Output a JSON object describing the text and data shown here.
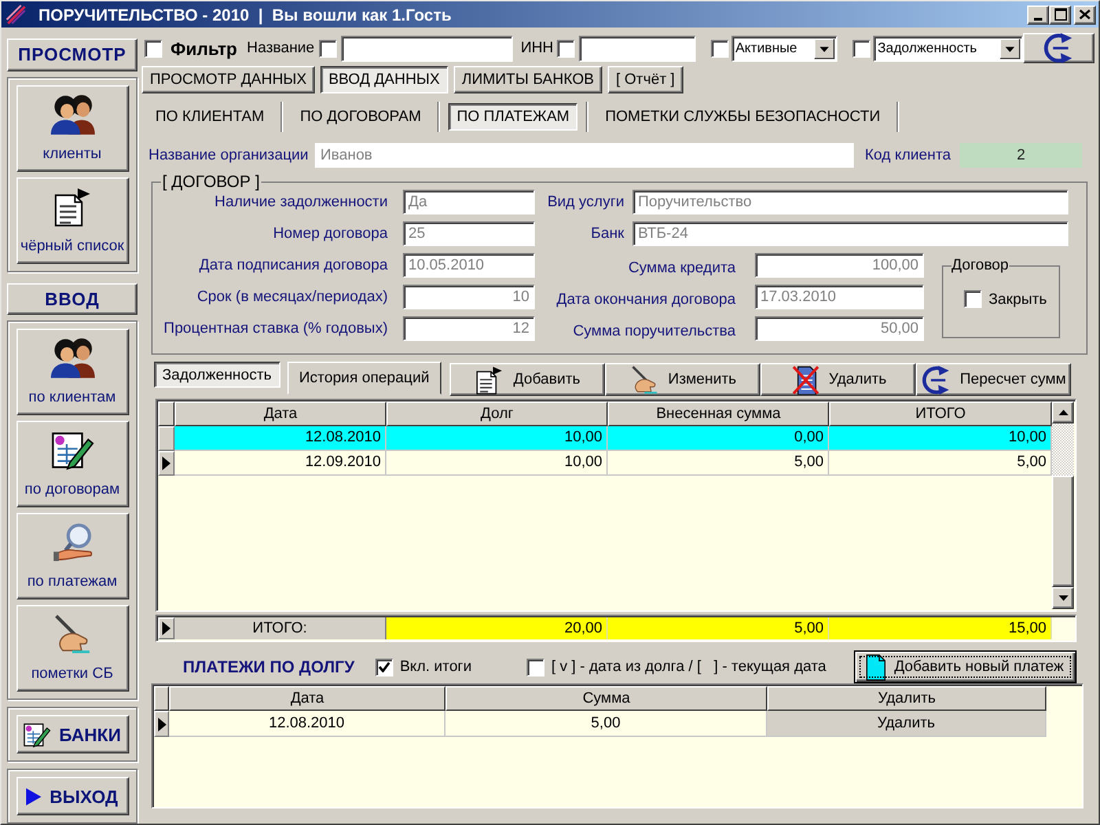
{
  "window": {
    "title": "ПОРУЧИТЕЛЬСТВО - 2010  |  Вы вошли как 1.Гость"
  },
  "sidebar": {
    "sections": [
      {
        "title": "ПРОСМОТР",
        "items": [
          {
            "label": "клиенты"
          },
          {
            "label": "чёрный список"
          }
        ]
      },
      {
        "title": "ВВОД",
        "items": [
          {
            "label": "по клиентам"
          },
          {
            "label": "по договорам"
          },
          {
            "label": "по платежам"
          },
          {
            "label": "пометки СБ"
          }
        ]
      }
    ],
    "buttons": [
      {
        "label": "БАНКИ"
      },
      {
        "label": "ВЫХОД"
      }
    ]
  },
  "filter": {
    "label": "Фильтр",
    "checked": false,
    "fields": [
      {
        "label": "Название",
        "checked": false
      },
      {
        "label": "ИНН",
        "checked": false
      }
    ],
    "dropdowns": [
      {
        "value": "Активные",
        "checked": false
      },
      {
        "value": "Задолженность",
        "checked": false
      }
    ]
  },
  "tabs": [
    {
      "label": "ПРОСМОТР ДАННЫХ",
      "selected": false
    },
    {
      "label": "ВВОД ДАННЫХ",
      "selected": true
    },
    {
      "label": "ЛИМИТЫ БАНКОВ",
      "selected": false
    },
    {
      "label": "[ Отчёт ]",
      "selected": false
    }
  ],
  "subtabs": [
    {
      "label": "ПО КЛИЕНТАМ",
      "selected": false
    },
    {
      "label": "ПО ДОГОВОРАМ",
      "selected": false
    },
    {
      "label": "ПО ПЛАТЕЖАМ",
      "selected": true
    },
    {
      "label": "ПОМЕТКИ СЛУЖБЫ БЕЗОПАСНОСТИ",
      "selected": false
    }
  ],
  "client": {
    "name_label": "Название организации",
    "name": "Иванов",
    "code_label": "Код клиента",
    "code": "2"
  },
  "contract": {
    "title": "[ ДОГОВОР ]",
    "left_fields": [
      {
        "label": "Наличие задолженности",
        "value": "Да",
        "kind": "text"
      },
      {
        "label": "Номер договора",
        "value": "25",
        "kind": "text"
      },
      {
        "label": "Дата подписания договора",
        "value": "10.05.2010",
        "kind": "text"
      },
      {
        "label": "Срок (в месяцах/периодах)",
        "value": "10",
        "kind": "number"
      },
      {
        "label": "Процентная ставка (% годовых)",
        "value": "12",
        "kind": "number"
      }
    ],
    "right_top_fields": [
      {
        "label": "Вид услуги",
        "value": "Поручительство",
        "kind": "text"
      },
      {
        "label": "Банк",
        "value": "ВТБ-24",
        "kind": "text"
      }
    ],
    "right_fields": [
      {
        "label": "Сумма кредита",
        "value": "100,00",
        "kind": "number"
      },
      {
        "label": "Дата окончания договора",
        "value": "17.03.2010",
        "kind": "text"
      },
      {
        "label": "Сумма поручительства",
        "value": "50,00",
        "kind": "number"
      }
    ],
    "close_group": {
      "title": "Договор",
      "label": "Закрыть",
      "checked": false
    }
  },
  "debt_tabs": [
    {
      "label": "Задолженность",
      "selected": true
    },
    {
      "label": "История операций",
      "selected": false
    }
  ],
  "toolbar": [
    {
      "label": "Добавить"
    },
    {
      "label": "Изменить"
    },
    {
      "label": "Удалить"
    },
    {
      "label": "Пересчет сумм"
    }
  ],
  "debts": {
    "columns": [
      "Дата",
      "Долг",
      "Внесенная сумма",
      "ИТОГО"
    ],
    "rows": [
      {
        "cells": [
          "12.08.2010",
          "10,00",
          "0,00",
          "10,00"
        ],
        "selected": true,
        "current": false
      },
      {
        "cells": [
          "12.09.2010",
          "10,00",
          "5,00",
          "5,00"
        ],
        "selected": false,
        "current": true
      }
    ],
    "totals": {
      "label": "ИТОГО:",
      "values": [
        "20,00",
        "5,00",
        "15,00"
      ],
      "current": true
    }
  },
  "payments": {
    "title": "ПЛАТЕЖИ ПО ДОЛГУ",
    "options": [
      {
        "label": "Вкл. итоги",
        "checked": true
      },
      {
        "label": "[ v ] - дата из долга / [   ] - текущая дата",
        "checked": false
      }
    ],
    "add_button": "Добавить новый платеж",
    "columns": [
      {
        "label": "Дата",
        "kind": "text"
      },
      {
        "label": "Сумма",
        "kind": "text"
      },
      {
        "label": "Удалить",
        "kind": "button"
      }
    ],
    "rows": [
      {
        "cells": [
          "12.08.2010",
          "5,00",
          "Удалить"
        ],
        "current": true
      }
    ]
  }
}
